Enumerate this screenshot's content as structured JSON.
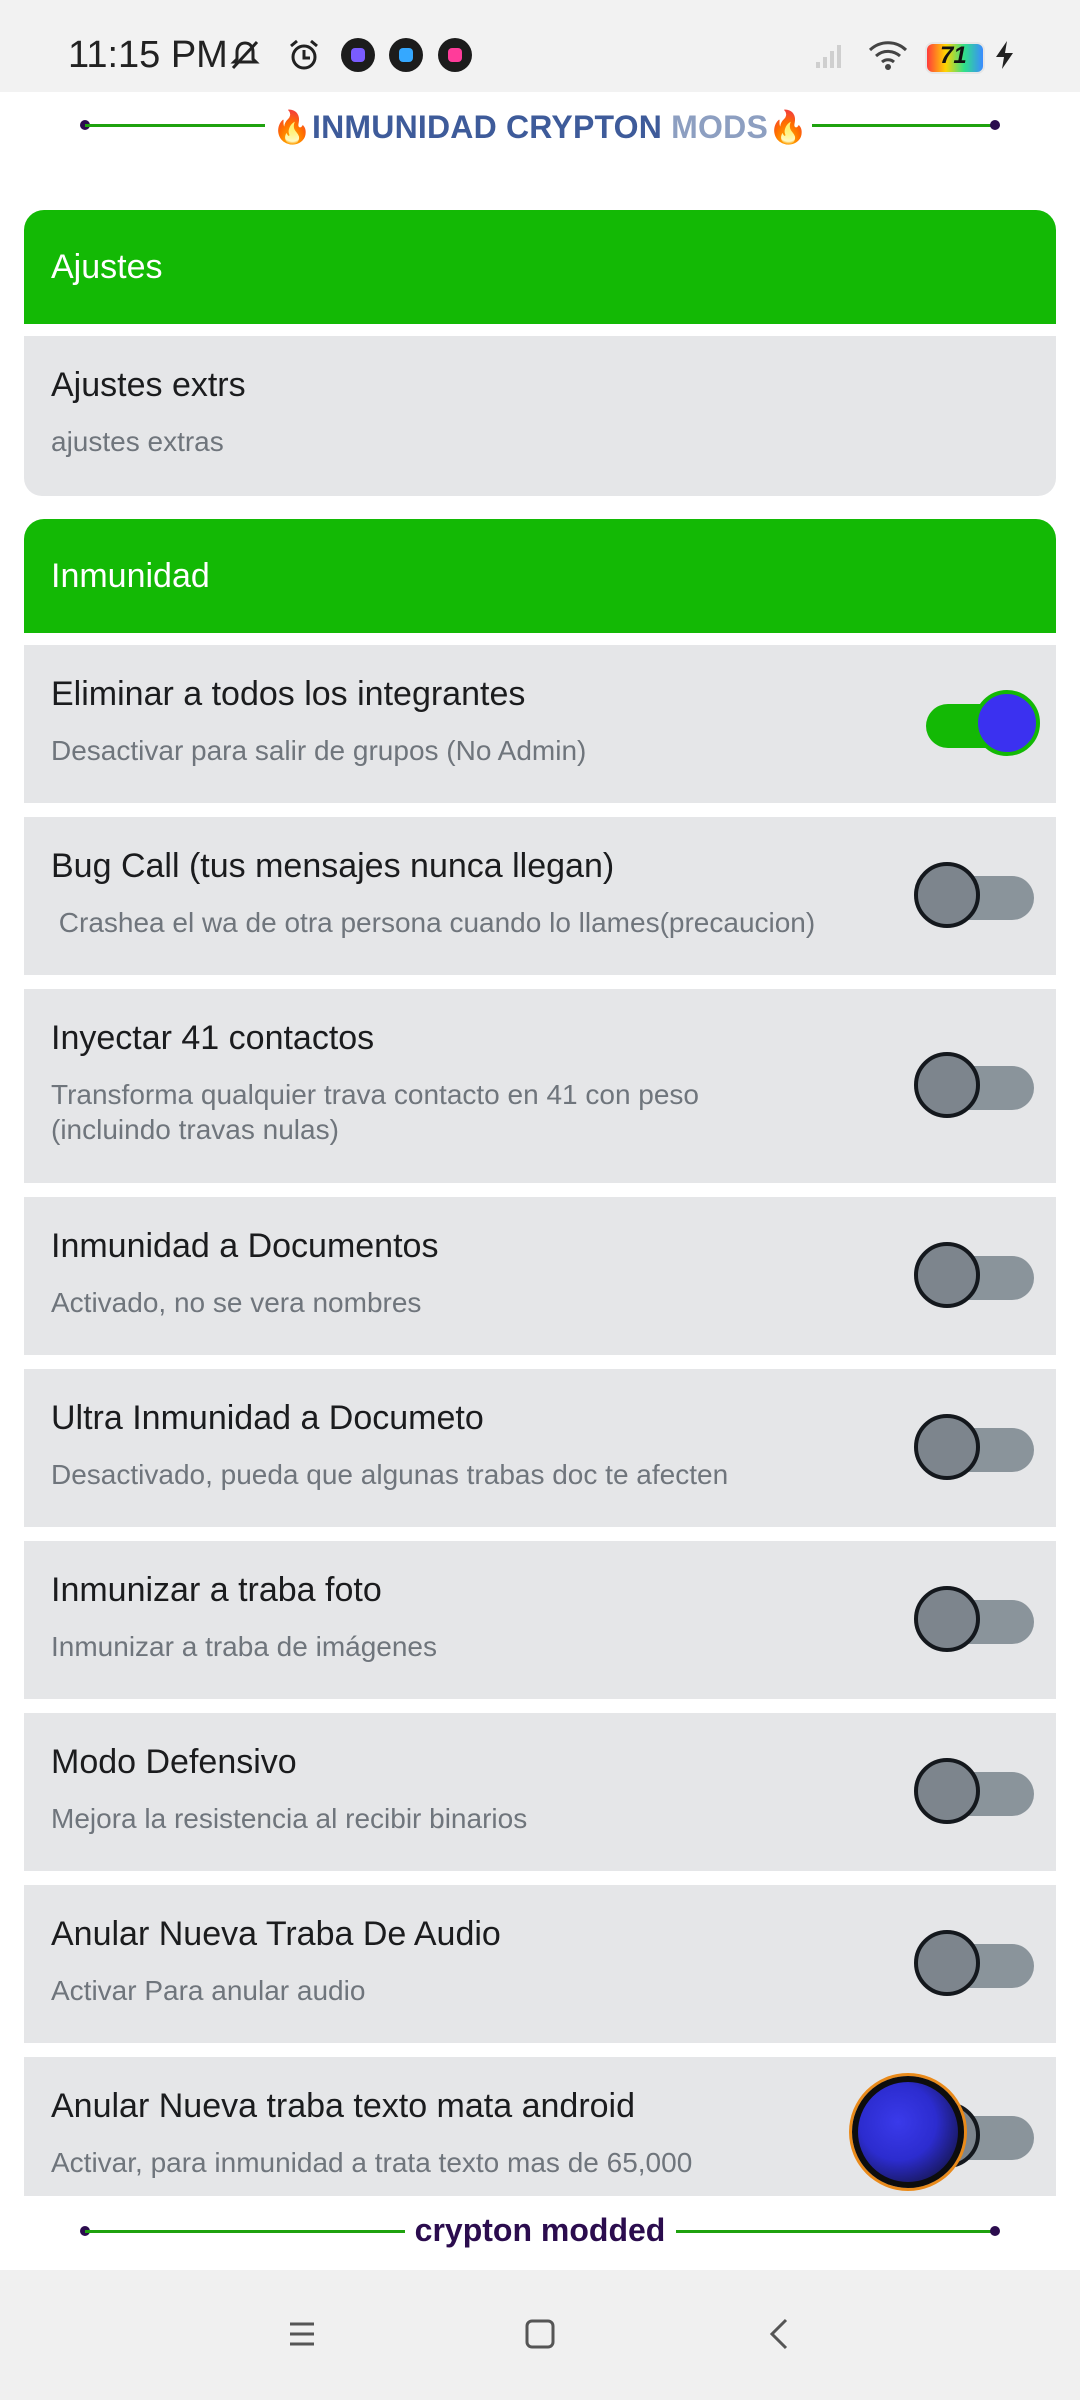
{
  "status_bar": {
    "time": "11:15 PM",
    "battery_level": "71",
    "icons": [
      "notifications-muted-icon",
      "alarm-icon",
      "app-notification-icon",
      "app-notification-icon",
      "app-notification-icon",
      "signal-icon",
      "wifi-icon",
      "battery-icon",
      "charging-icon"
    ]
  },
  "header": {
    "prefix_emoji": "🔥",
    "title_part1": "INMUNIDAD CRYPTON",
    "title_part2": " MODS",
    "suffix_emoji": "🔥"
  },
  "sections": [
    {
      "title": "Ajustes",
      "items": [
        {
          "title": "Ajustes extrs",
          "subtitle": "ajustes extras"
        }
      ]
    },
    {
      "title": "Inmunidad",
      "items": [
        {
          "title": "Eliminar a todos los integrantes",
          "subtitle": "Desactivar para salir de grupos (No Admin)",
          "enabled": true
        },
        {
          "title": "Bug Call (tus mensajes nunca llegan)",
          "subtitle": " Crashea el wa de otra persona cuando lo llames(precaucion)",
          "enabled": false
        },
        {
          "title": "Inyectar 41 contactos",
          "subtitle": "Transforma qualquier trava contacto en 41 con peso (incluindo travas nulas)",
          "enabled": false
        },
        {
          "title": "Inmunidad a Documentos",
          "subtitle": "Activado, no se vera nombres",
          "enabled": false
        },
        {
          "title": "Ultra Inmunidad a Documeto",
          "subtitle": "Desactivado, pueda que algunas trabas doc te afecten",
          "enabled": false
        },
        {
          "title": "Inmunizar a traba foto",
          "subtitle": "Inmunizar a traba de imágenes",
          "enabled": false
        },
        {
          "title": "Modo Defensivo",
          "subtitle": "Mejora la resistencia al recibir binarios",
          "enabled": false
        },
        {
          "title": "Anular Nueva Traba De Audio",
          "subtitle": "Activar Para anular audio",
          "enabled": false
        },
        {
          "title": "Anular Nueva traba texto mata android",
          "subtitle": "Activar, para inmunidad a trata texto mas de 65,000",
          "enabled": false
        }
      ]
    }
  ],
  "footer": {
    "text": "crypton modded"
  },
  "colors": {
    "section_header": "#13b905",
    "row_background": "#e5e6e8",
    "toggle_thumb_on": "#3b31f0",
    "footer_text": "#2b0c4e"
  }
}
